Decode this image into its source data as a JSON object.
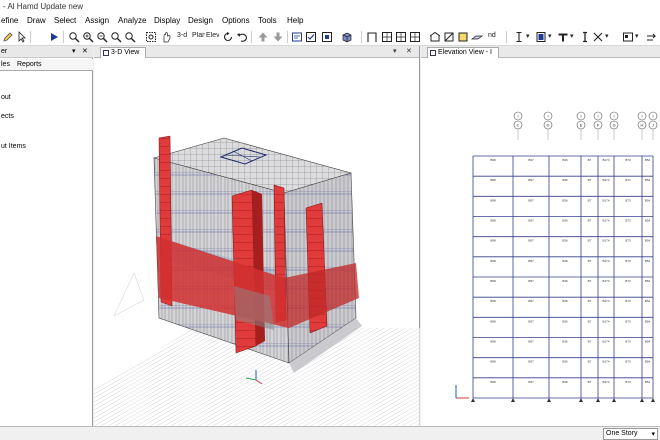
{
  "window": {
    "title": "- Al Hamd Update new"
  },
  "menu": [
    "efine",
    "Draw",
    "Select",
    "Assign",
    "Analyze",
    "Display",
    "Design",
    "Options",
    "Tools",
    "Help"
  ],
  "toolbar": {
    "view_3d_label": "3-d",
    "plan_label": "Plan",
    "elev_label": "Elev",
    "nd_label": "nd",
    "icons": [
      "pencil-icon",
      "pointer-icon",
      "play-icon",
      "zoom-window-icon",
      "zoom-in-icon",
      "zoom-out-icon",
      "zoom-restore-icon",
      "zoom-previous-icon",
      "pan-icon",
      "zoom-all-icon",
      "view-3d-icon",
      "plan-view-icon",
      "elevation-view-icon",
      "rotate-icon",
      "undo-icon",
      "move-up-icon",
      "move-down-icon",
      "select-all-icon",
      "display-options-icon",
      "object-shrink-icon",
      "extrude-icon",
      "frame-icon",
      "area-icon",
      "section-icon",
      "beam-icon",
      "column-icon",
      "brace-icon",
      "wall-icon",
      "slab-icon",
      "member-icon"
    ]
  },
  "explorer": {
    "title": "er",
    "tabs": [
      "les",
      "Reports"
    ],
    "items": [
      "out",
      "ects",
      "ut Items"
    ]
  },
  "views": {
    "left_tab": "3-D View",
    "right_tab": "Elevation View - I",
    "pin_glyph": "▾",
    "close_glyph": "✕"
  },
  "elevation": {
    "grid_bubbles": [
      {
        "top": "I",
        "bottom": "C"
      },
      {
        "top": "I",
        "bottom": "D"
      },
      {
        "top": "I",
        "bottom": "E"
      },
      {
        "top": "I",
        "bottom": "F"
      },
      {
        "top": "I",
        "bottom": "G"
      },
      {
        "top": "I",
        "bottom": "H"
      },
      {
        "top": "I",
        "bottom": "J"
      }
    ],
    "member_labels": [
      "B98",
      "B97",
      "B36",
      "B7",
      "B174",
      "B73",
      "B54"
    ]
  },
  "status": {
    "story": "One Story"
  },
  "colors": {
    "accent": "#1560bd",
    "shearwall": "#e03a3a",
    "frame": "#3d4fa0"
  }
}
